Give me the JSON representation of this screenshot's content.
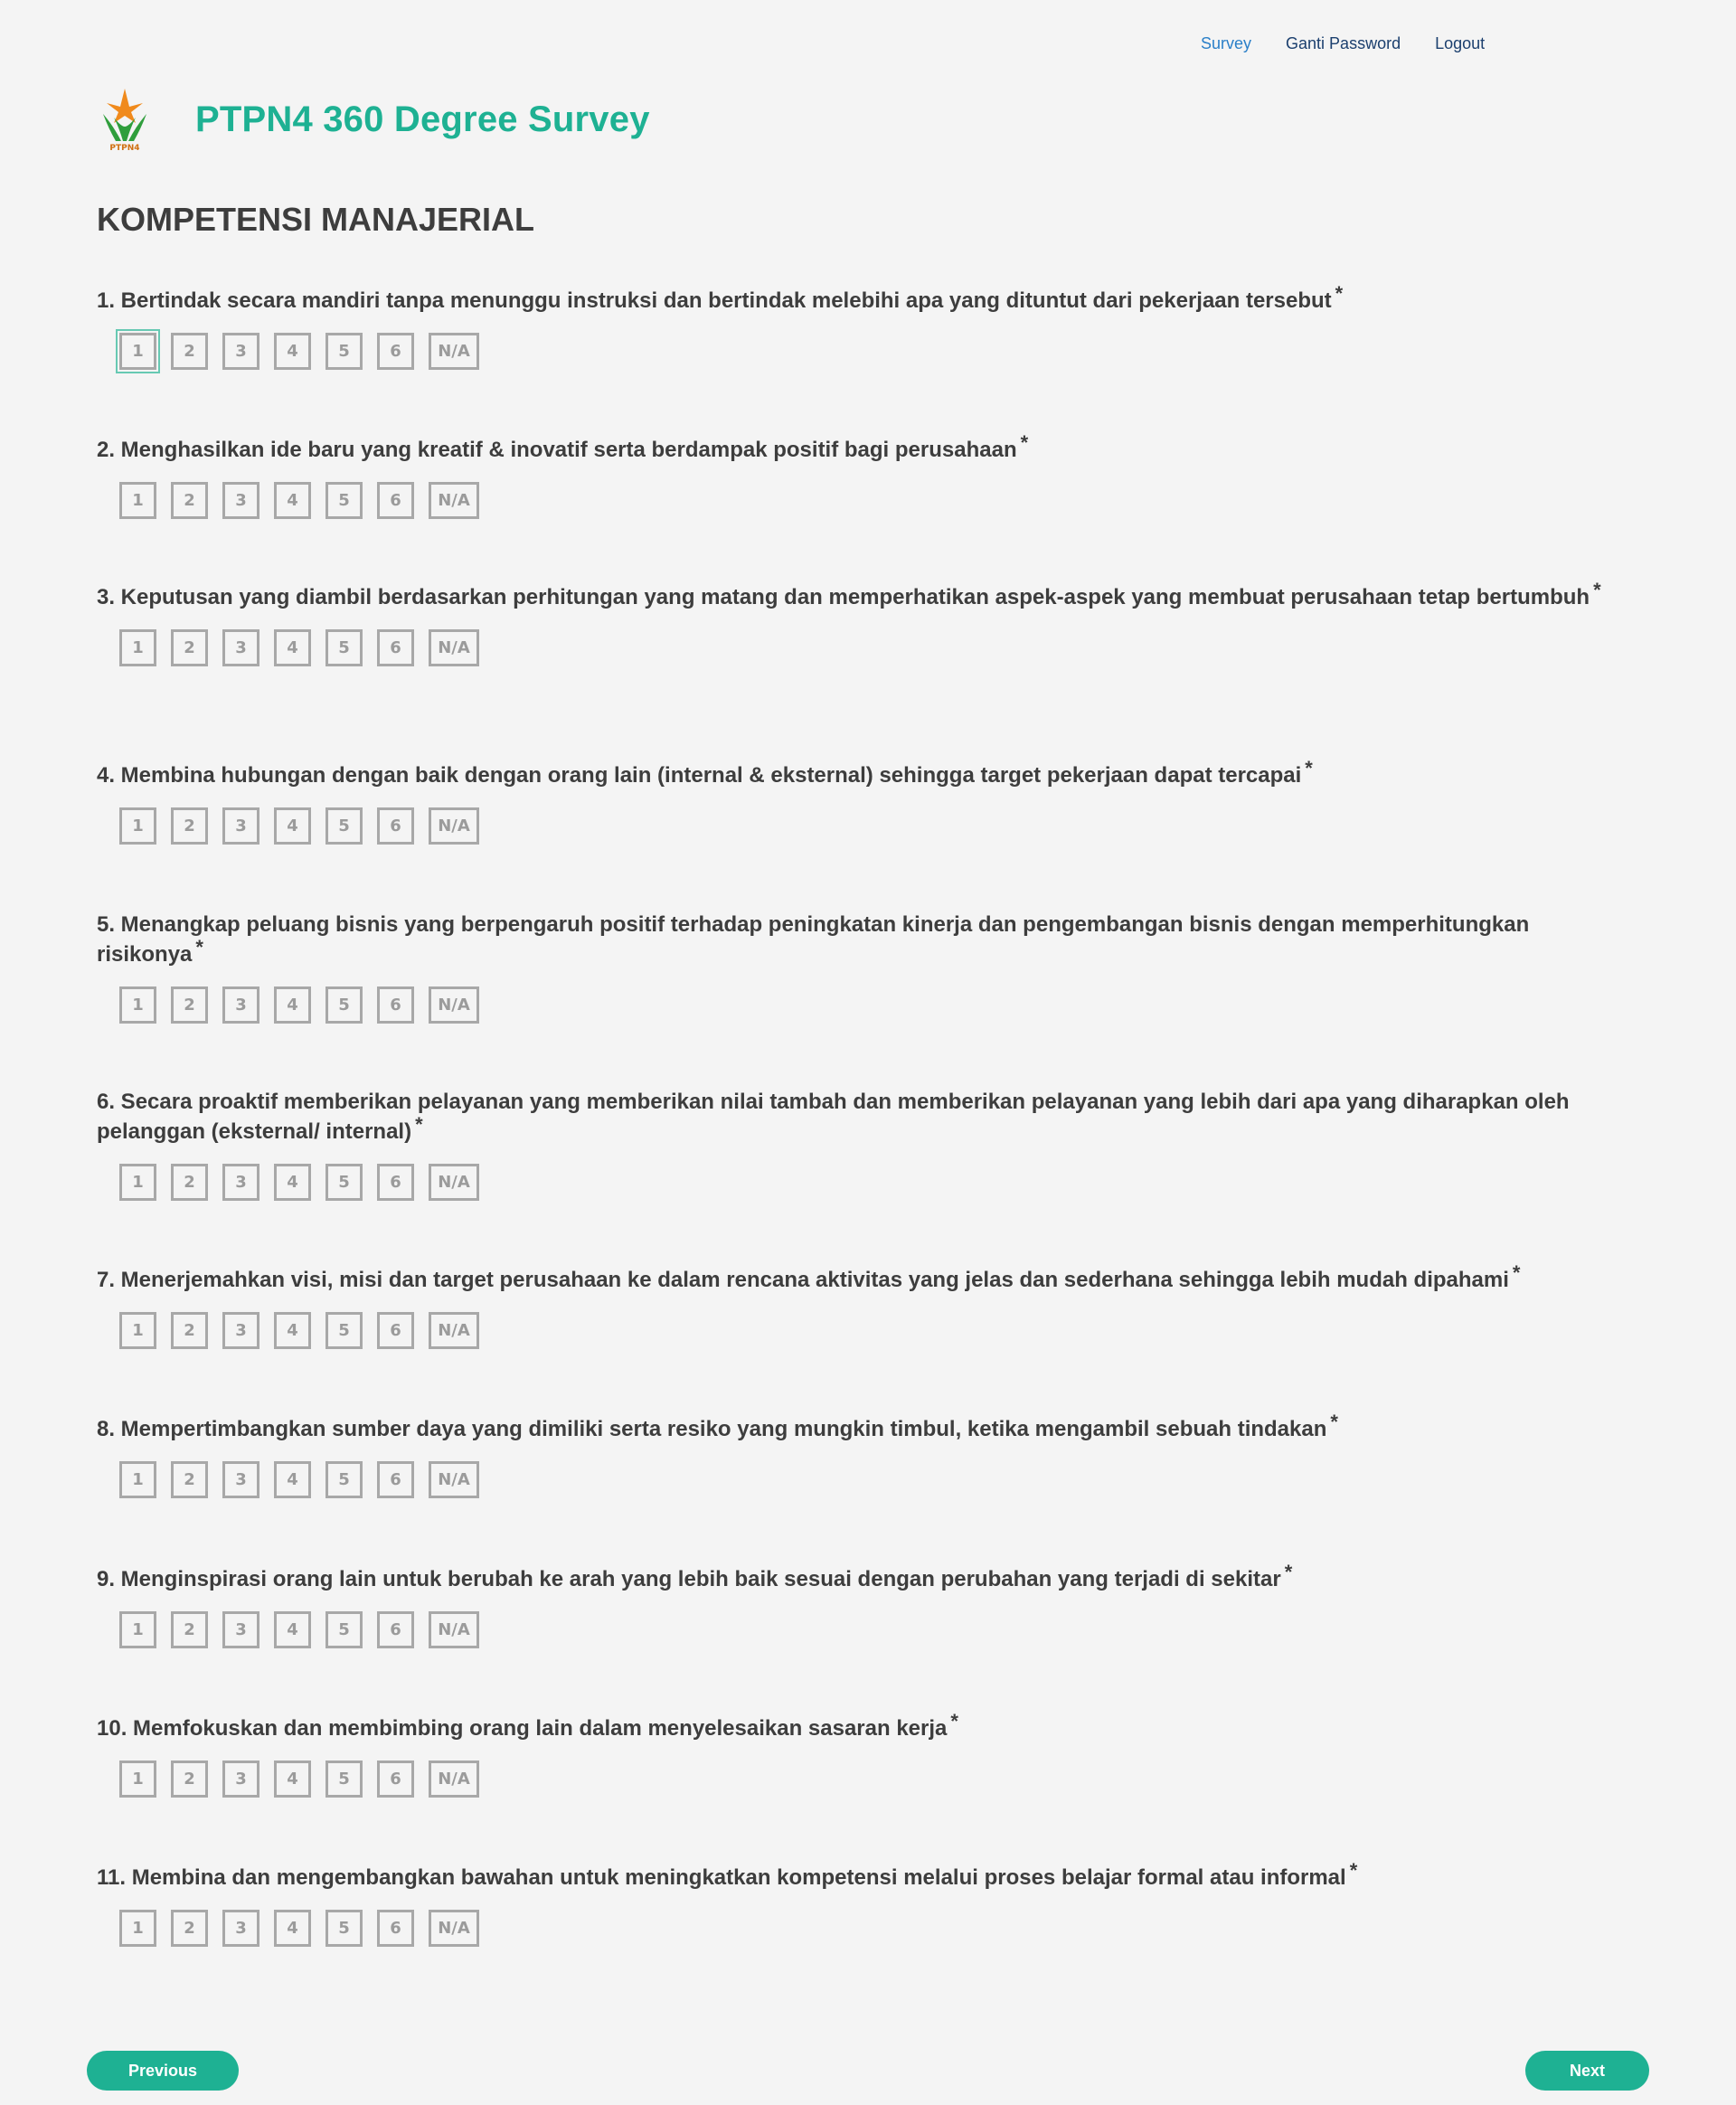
{
  "nav": {
    "survey": "Survey",
    "change_password": "Ganti Password",
    "logout": "Logout"
  },
  "brand": {
    "title": "PTPN4 360 Degree Survey",
    "logo_text": "PTPN4"
  },
  "section_title": "KOMPETENSI MANAJERIAL",
  "options": [
    "1",
    "2",
    "3",
    "4",
    "5",
    "6",
    "N/A"
  ],
  "required_mark": "*",
  "questions": [
    "1. Bertindak secara mandiri tanpa menunggu instruksi dan bertindak melebihi apa yang dituntut dari pekerjaan tersebut",
    "2. Menghasilkan ide baru yang kreatif & inovatif serta berdampak positif bagi perusahaan",
    "3. Keputusan yang diambil berdasarkan perhitungan yang matang dan memperhatikan aspek-aspek yang membuat perusahaan tetap bertumbuh",
    "4. Membina hubungan dengan baik dengan orang lain (internal & eksternal) sehingga target pekerjaan dapat tercapai",
    "5. Menangkap peluang bisnis yang berpengaruh positif terhadap peningkatan kinerja dan pengembangan bisnis dengan memperhitungkan risikonya",
    "6. Secara proaktif memberikan pelayanan yang memberikan nilai tambah dan memberikan pelayanan yang lebih dari apa yang diharapkan oleh pelanggan (eksternal/ internal)",
    "7. Menerjemahkan visi, misi dan target perusahaan ke dalam rencana aktivitas yang jelas dan sederhana sehingga lebih mudah dipahami",
    "8. Mempertimbangkan sumber daya yang dimiliki serta resiko yang mungkin timbul, ketika mengambil sebuah tindakan",
    "9. Menginspirasi orang lain untuk berubah ke arah yang lebih baik sesuai dengan perubahan yang terjadi di sekitar",
    "10. Memfokuskan dan membimbing orang lain dalam menyelesaikan sasaran kerja",
    "11. Membina dan mengembangkan bawahan untuk meningkatkan kompetensi melalui proses belajar formal atau informal"
  ],
  "buttons": {
    "previous": "Previous",
    "next": "Next"
  },
  "colors": {
    "accent": "#1eb193",
    "nav_active": "#2a7fc8",
    "nav": "#1b3f6e"
  }
}
